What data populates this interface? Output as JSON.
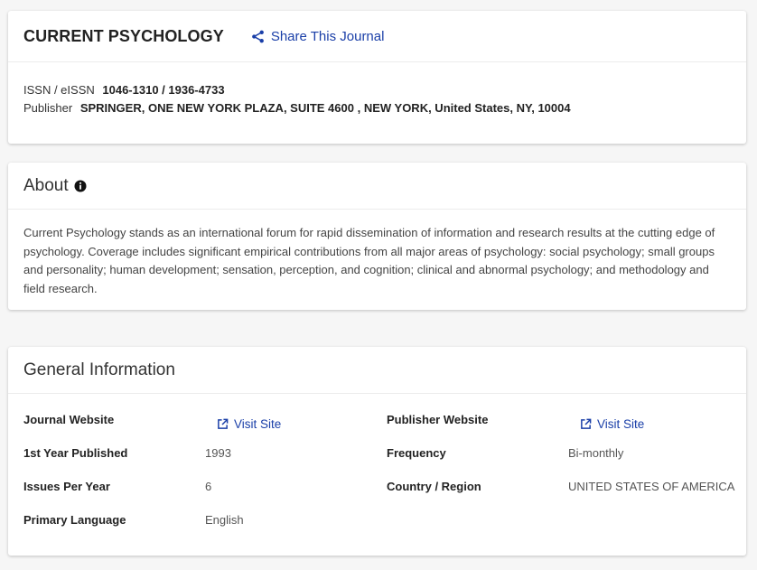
{
  "journal": {
    "title": "CURRENT PSYCHOLOGY",
    "share_label": "Share This Journal",
    "issn_label": "ISSN / eISSN",
    "issn_value": "1046-1310 / 1936-4733",
    "publisher_label": "Publisher",
    "publisher_value": "SPRINGER, ONE NEW YORK PLAZA, SUITE 4600 , NEW YORK, United States, NY, 10004"
  },
  "about": {
    "title": "About",
    "text": "Current Psychology stands as an international forum for rapid dissemination of information and research results at the cutting edge of psychology. Coverage includes significant empirical contributions from all major areas of psychology: social psychology; small groups and personality; human development; sensation, perception, and cognition; clinical and abnormal psychology; and methodology and field research."
  },
  "general": {
    "title": "General Information",
    "journal_website_label": "Journal Website",
    "journal_website_link": "Visit Site",
    "publisher_website_label": "Publisher Website",
    "publisher_website_link": "Visit Site",
    "first_year_label": "1st Year Published",
    "first_year_value": "1993",
    "frequency_label": "Frequency",
    "frequency_value": "Bi-monthly",
    "issues_label": "Issues Per Year",
    "issues_value": "6",
    "country_label": "Country / Region",
    "country_value": "UNITED STATES OF AMERICA",
    "language_label": "Primary Language",
    "language_value": "English"
  },
  "colors": {
    "link": "#1a3fa8",
    "background": "#f6f6f6"
  }
}
